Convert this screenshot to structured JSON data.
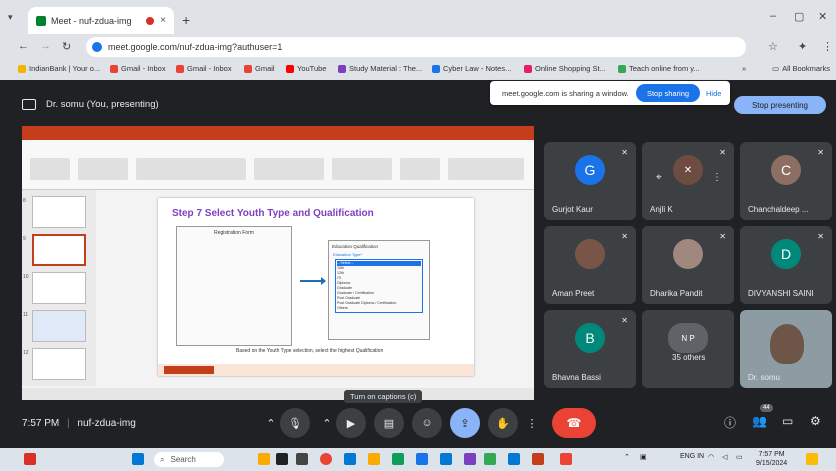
{
  "browser": {
    "tab_title": "Meet - nuf-zdua-img",
    "tab_close": "×",
    "new_tab": "+",
    "minimize": "–",
    "maximize": "▢",
    "close": "✕",
    "url": "meet.google.com/nuf-zdua-img?authuser=1",
    "bookmarks": [
      {
        "label": "IndianBank | Your o...",
        "color": "#f4b400"
      },
      {
        "label": "Gmail - Inbox",
        "color": "#ea4335"
      },
      {
        "label": "Gmail - Inbox",
        "color": "#ea4335"
      },
      {
        "label": "Gmail",
        "color": "#ea4335"
      },
      {
        "label": "YouTube",
        "color": "#ff0000"
      },
      {
        "label": "Study Material : The...",
        "color": "#7b3fbf"
      },
      {
        "label": "Cyber Law - Notes...",
        "color": "#1a73e8"
      },
      {
        "label": "Online Shopping St...",
        "color": "#e91e63"
      },
      {
        "label": "Teach online from y...",
        "color": "#34a853"
      }
    ],
    "bookmarks_more": "»",
    "all_bookmarks": "All Bookmarks"
  },
  "meet": {
    "presenting_label": "Dr. somu (You, presenting)",
    "share_notice": "meet.google.com is sharing a window.",
    "stop_sharing": "Stop sharing",
    "hide": "Hide",
    "stop_presenting": "Stop presenting",
    "slide": {
      "title": "Step 7 Select Youth Type and Qualification",
      "form1_title": "Registration Form",
      "form2_title": "Education Qualification",
      "form2_field": "Education Type*",
      "form2_options": [
        "-- Select --",
        "10th",
        "12th",
        "ITI",
        "Diploma",
        "Graduate",
        "Graduate / Certification",
        "Post Graduate",
        "Post Graduate Diploma / Certification",
        "Others"
      ],
      "caption": "Based on the Youth Type selection, select the highest Qualification"
    },
    "thumb_numbers": [
      "8",
      "9",
      "10",
      "11",
      "12"
    ],
    "participants": [
      {
        "name": "Gurjot Kaur",
        "initial": "G",
        "color": "#1a73e8"
      },
      {
        "name": "Anjli K",
        "initial": "",
        "color": "#6d4c41"
      },
      {
        "name": "Chanchaldeep ...",
        "initial": "C",
        "color": "#8d6e63"
      },
      {
        "name": "Aman Preet",
        "initial": "",
        "color": "#795548"
      },
      {
        "name": "Dharika Pandit",
        "initial": "",
        "color": "#a1887f"
      },
      {
        "name": "DIVYANSHI SAINI",
        "initial": "D",
        "color": "#00897b"
      },
      {
        "name": "Bhavna Bassi",
        "initial": "B",
        "color": "#00897b"
      },
      {
        "name": "35 others",
        "initial": "N P",
        "color": "#5f6368"
      },
      {
        "name": "Dr. somu",
        "initial": "",
        "color": "#b0bec5"
      }
    ],
    "tooltip": "Turn on captions (c)",
    "time": "7:57 PM",
    "meeting_code": "nuf-zdua-img",
    "participant_count": "44"
  },
  "taskbar": {
    "search": "Search",
    "lang": "ENG IN",
    "clock_time": "7:57 PM",
    "clock_date": "9/15/2024"
  }
}
